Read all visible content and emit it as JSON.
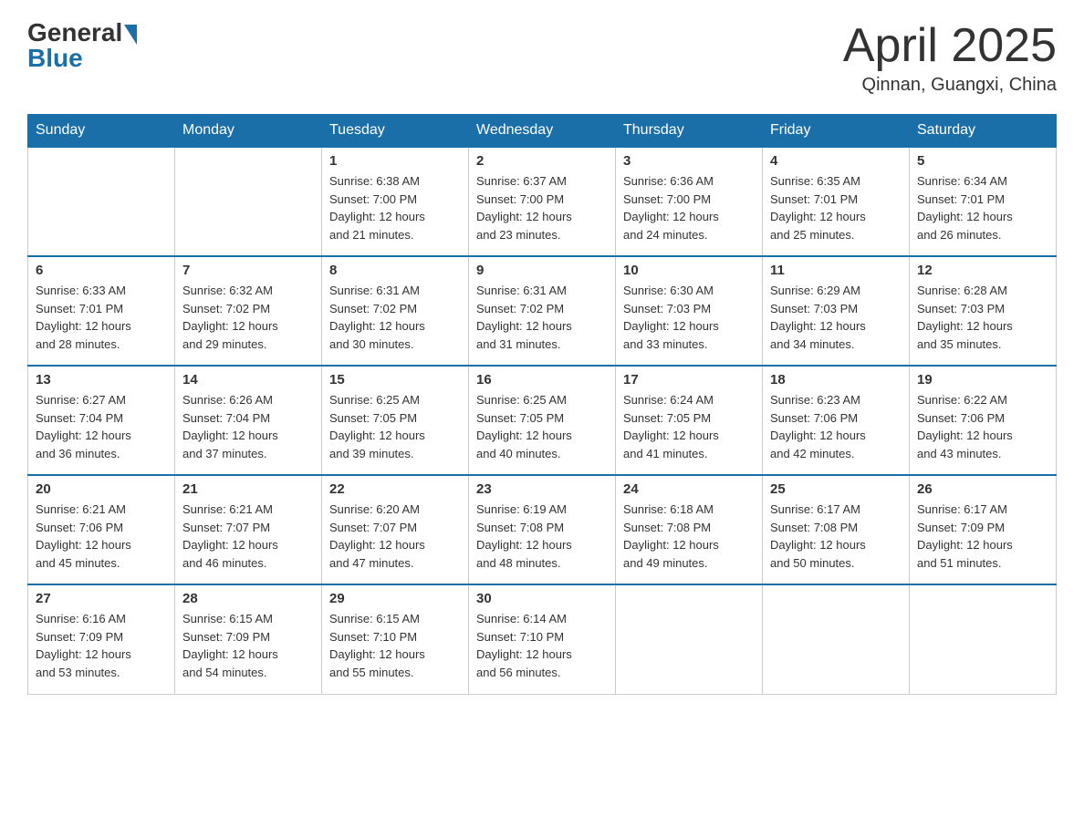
{
  "header": {
    "logo_general": "General",
    "logo_blue": "Blue",
    "title": "April 2025",
    "subtitle": "Qinnan, Guangxi, China"
  },
  "days_of_week": [
    "Sunday",
    "Monday",
    "Tuesday",
    "Wednesday",
    "Thursday",
    "Friday",
    "Saturday"
  ],
  "weeks": [
    [
      {
        "day": "",
        "info": ""
      },
      {
        "day": "",
        "info": ""
      },
      {
        "day": "1",
        "info": "Sunrise: 6:38 AM\nSunset: 7:00 PM\nDaylight: 12 hours\nand 21 minutes."
      },
      {
        "day": "2",
        "info": "Sunrise: 6:37 AM\nSunset: 7:00 PM\nDaylight: 12 hours\nand 23 minutes."
      },
      {
        "day": "3",
        "info": "Sunrise: 6:36 AM\nSunset: 7:00 PM\nDaylight: 12 hours\nand 24 minutes."
      },
      {
        "day": "4",
        "info": "Sunrise: 6:35 AM\nSunset: 7:01 PM\nDaylight: 12 hours\nand 25 minutes."
      },
      {
        "day": "5",
        "info": "Sunrise: 6:34 AM\nSunset: 7:01 PM\nDaylight: 12 hours\nand 26 minutes."
      }
    ],
    [
      {
        "day": "6",
        "info": "Sunrise: 6:33 AM\nSunset: 7:01 PM\nDaylight: 12 hours\nand 28 minutes."
      },
      {
        "day": "7",
        "info": "Sunrise: 6:32 AM\nSunset: 7:02 PM\nDaylight: 12 hours\nand 29 minutes."
      },
      {
        "day": "8",
        "info": "Sunrise: 6:31 AM\nSunset: 7:02 PM\nDaylight: 12 hours\nand 30 minutes."
      },
      {
        "day": "9",
        "info": "Sunrise: 6:31 AM\nSunset: 7:02 PM\nDaylight: 12 hours\nand 31 minutes."
      },
      {
        "day": "10",
        "info": "Sunrise: 6:30 AM\nSunset: 7:03 PM\nDaylight: 12 hours\nand 33 minutes."
      },
      {
        "day": "11",
        "info": "Sunrise: 6:29 AM\nSunset: 7:03 PM\nDaylight: 12 hours\nand 34 minutes."
      },
      {
        "day": "12",
        "info": "Sunrise: 6:28 AM\nSunset: 7:03 PM\nDaylight: 12 hours\nand 35 minutes."
      }
    ],
    [
      {
        "day": "13",
        "info": "Sunrise: 6:27 AM\nSunset: 7:04 PM\nDaylight: 12 hours\nand 36 minutes."
      },
      {
        "day": "14",
        "info": "Sunrise: 6:26 AM\nSunset: 7:04 PM\nDaylight: 12 hours\nand 37 minutes."
      },
      {
        "day": "15",
        "info": "Sunrise: 6:25 AM\nSunset: 7:05 PM\nDaylight: 12 hours\nand 39 minutes."
      },
      {
        "day": "16",
        "info": "Sunrise: 6:25 AM\nSunset: 7:05 PM\nDaylight: 12 hours\nand 40 minutes."
      },
      {
        "day": "17",
        "info": "Sunrise: 6:24 AM\nSunset: 7:05 PM\nDaylight: 12 hours\nand 41 minutes."
      },
      {
        "day": "18",
        "info": "Sunrise: 6:23 AM\nSunset: 7:06 PM\nDaylight: 12 hours\nand 42 minutes."
      },
      {
        "day": "19",
        "info": "Sunrise: 6:22 AM\nSunset: 7:06 PM\nDaylight: 12 hours\nand 43 minutes."
      }
    ],
    [
      {
        "day": "20",
        "info": "Sunrise: 6:21 AM\nSunset: 7:06 PM\nDaylight: 12 hours\nand 45 minutes."
      },
      {
        "day": "21",
        "info": "Sunrise: 6:21 AM\nSunset: 7:07 PM\nDaylight: 12 hours\nand 46 minutes."
      },
      {
        "day": "22",
        "info": "Sunrise: 6:20 AM\nSunset: 7:07 PM\nDaylight: 12 hours\nand 47 minutes."
      },
      {
        "day": "23",
        "info": "Sunrise: 6:19 AM\nSunset: 7:08 PM\nDaylight: 12 hours\nand 48 minutes."
      },
      {
        "day": "24",
        "info": "Sunrise: 6:18 AM\nSunset: 7:08 PM\nDaylight: 12 hours\nand 49 minutes."
      },
      {
        "day": "25",
        "info": "Sunrise: 6:17 AM\nSunset: 7:08 PM\nDaylight: 12 hours\nand 50 minutes."
      },
      {
        "day": "26",
        "info": "Sunrise: 6:17 AM\nSunset: 7:09 PM\nDaylight: 12 hours\nand 51 minutes."
      }
    ],
    [
      {
        "day": "27",
        "info": "Sunrise: 6:16 AM\nSunset: 7:09 PM\nDaylight: 12 hours\nand 53 minutes."
      },
      {
        "day": "28",
        "info": "Sunrise: 6:15 AM\nSunset: 7:09 PM\nDaylight: 12 hours\nand 54 minutes."
      },
      {
        "day": "29",
        "info": "Sunrise: 6:15 AM\nSunset: 7:10 PM\nDaylight: 12 hours\nand 55 minutes."
      },
      {
        "day": "30",
        "info": "Sunrise: 6:14 AM\nSunset: 7:10 PM\nDaylight: 12 hours\nand 56 minutes."
      },
      {
        "day": "",
        "info": ""
      },
      {
        "day": "",
        "info": ""
      },
      {
        "day": "",
        "info": ""
      }
    ]
  ]
}
